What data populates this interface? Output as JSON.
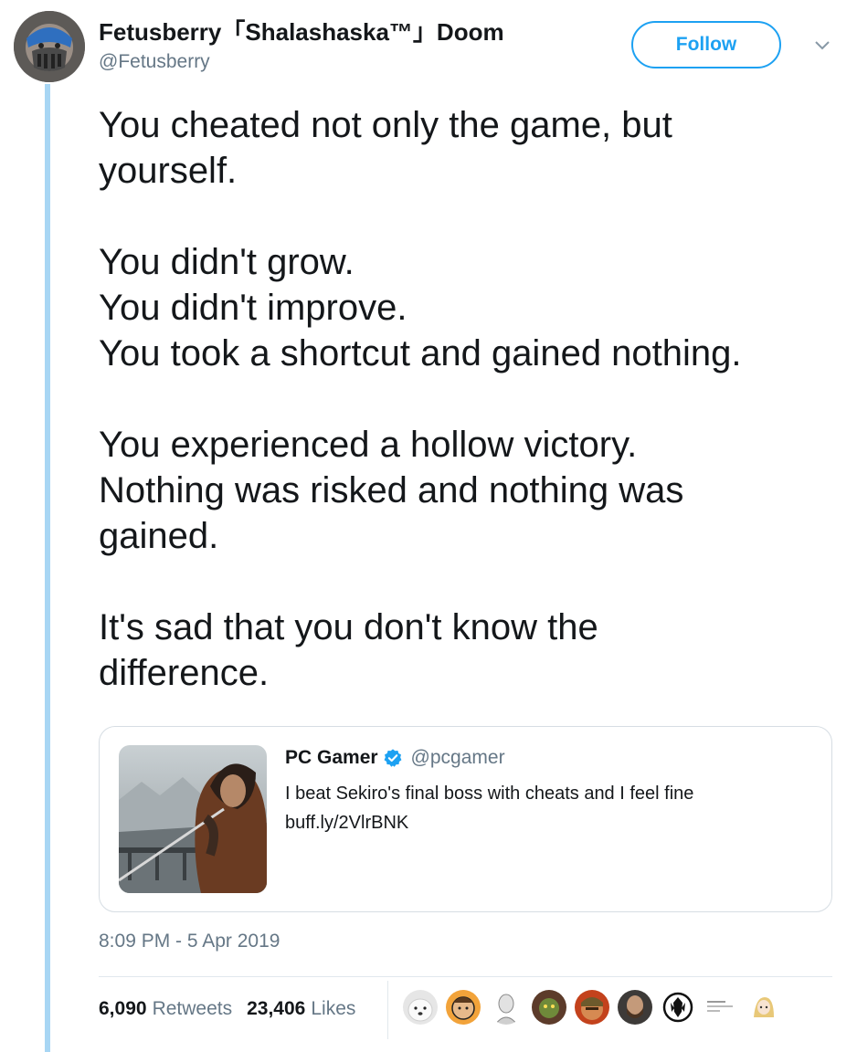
{
  "author": {
    "name": "Fetusberry「Shalashaska™」Doom",
    "handle": "@Fetusberry",
    "avatar_icon": "bane-mask-avatar"
  },
  "follow_button": {
    "label": "Follow"
  },
  "menu_icon": "chevron-down-icon",
  "tweet": {
    "paragraphs": [
      [
        "You cheated not only the game, but",
        "yourself."
      ],
      [
        "You didn't grow.",
        "You didn't improve.",
        "You took a shortcut and gained nothing."
      ],
      [
        "You experienced a hollow victory.",
        "Nothing was risked and nothing was",
        "gained."
      ],
      [
        "It's sad that you don't know the",
        "difference."
      ]
    ]
  },
  "quoted_tweet": {
    "name": "PC Gamer",
    "verified": true,
    "handle": "@pcgamer",
    "text_line1": "I beat Sekiro's final boss with cheats and I feel fine",
    "text_line2": "buff.ly/2VlrBNK",
    "thumbnail_icon": "sekiro-thumbnail"
  },
  "timestamp": "8:09 PM - 5 Apr 2019",
  "stats": {
    "retweets_count": "6,090",
    "retweets_label": "Retweets",
    "likes_count": "23,406",
    "likes_label": "Likes"
  },
  "colors": {
    "accent": "#1da1f2",
    "secondary_text": "#657786",
    "thread_line": "#a8d6f4",
    "border": "#d6dde3"
  }
}
